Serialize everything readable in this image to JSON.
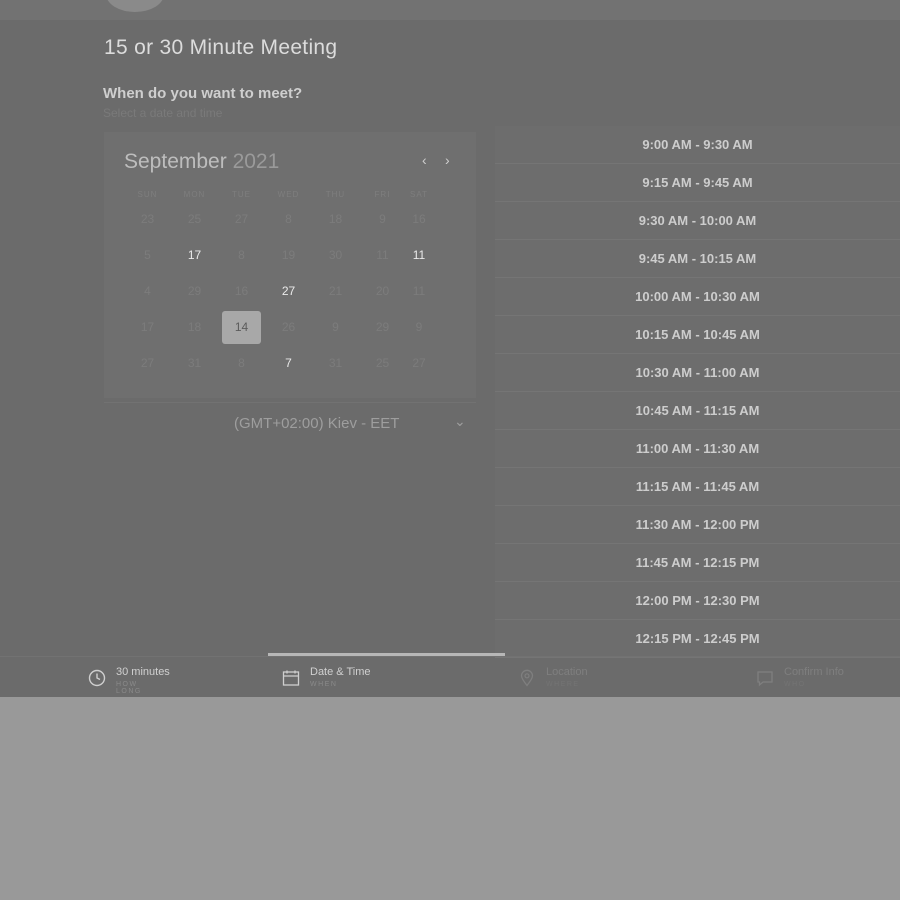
{
  "meeting": {
    "title": "15 or 30 Minute Meeting",
    "question": "When do you want to meet?",
    "hint": "Select a date and time"
  },
  "calendar": {
    "month": "September",
    "year": "2021",
    "prev_icon": "chevron-left-icon",
    "next_icon": "chevron-right-icon",
    "weekdays": [
      "SUN",
      "MON",
      "TUE",
      "WED",
      "THU",
      "FRI",
      "SAT"
    ],
    "weeks": [
      [
        "23",
        "25",
        "27",
        "8",
        "18",
        "9",
        "16"
      ],
      [
        "5",
        "17",
        "8",
        "19",
        "30",
        "11",
        "11"
      ],
      [
        "4",
        "29",
        "16",
        "27",
        "21",
        "20",
        "11"
      ],
      [
        "17",
        "18",
        "14",
        "26",
        "9",
        "29",
        "9"
      ],
      [
        "27",
        "31",
        "8",
        "7",
        "31",
        "25",
        "27"
      ]
    ],
    "available": [
      "1-1",
      "1-6",
      "2-3",
      "4-3"
    ],
    "selected": "3-2"
  },
  "timezone": {
    "label": "(GMT+02:00) Kiev - EET",
    "icon": "chevron-down-icon"
  },
  "slots": [
    "9:00 AM - 9:30 AM",
    "9:15 AM - 9:45 AM",
    "9:30 AM - 10:00 AM",
    "9:45 AM - 10:15 AM",
    "10:00 AM - 10:30 AM",
    "10:15 AM - 10:45 AM",
    "10:30 AM - 11:00 AM",
    "10:45 AM - 11:15 AM",
    "11:00 AM - 11:30 AM",
    "11:15 AM - 11:45 AM",
    "11:30 AM - 12:00 PM",
    "11:45 AM - 12:15 PM",
    "12:00 PM - 12:30 PM",
    "12:15 PM - 12:45 PM"
  ],
  "steps": [
    {
      "label": "30 minutes",
      "sub": "HOW LONG",
      "icon": "clock-icon",
      "active": true
    },
    {
      "label": "Date & Time",
      "sub": "WHEN",
      "icon": "calendar-icon",
      "active": true
    },
    {
      "label": "Location",
      "sub": "WHERE",
      "icon": "location-pin-icon",
      "active": false
    },
    {
      "label": "Confirm Info",
      "sub": "WHO",
      "icon": "chat-icon",
      "active": false
    }
  ]
}
